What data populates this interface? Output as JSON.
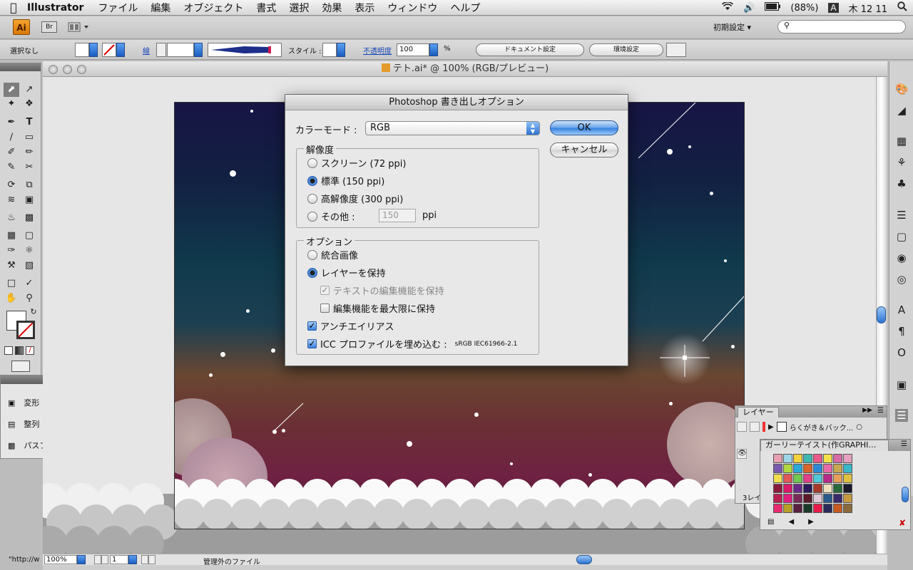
{
  "menubar": {
    "app_name": "Illustrator",
    "menus": [
      "ファイル",
      "編集",
      "オブジェクト",
      "書式",
      "選択",
      "効果",
      "表示",
      "ウィンドウ",
      "ヘルプ"
    ],
    "battery": "(88%)",
    "input_indicator": "A",
    "clock": "木 12 11"
  },
  "appbar": {
    "ai_badge": "Ai",
    "br_badge": "Br",
    "workspace": "初期設定 ▾"
  },
  "controlbar": {
    "selection_status": "選択なし",
    "stroke_label": "線",
    "style_label": "スタイル :",
    "opacity_label": "不透明度",
    "opacity_value": "100",
    "percent": "%",
    "document_settings": "ドキュメント設定",
    "preferences": "環境設定"
  },
  "document": {
    "title": "テト.ai* @ 100% (RGB/プレビュー)"
  },
  "statusbar": {
    "url_text": "\"http://w",
    "zoom": "100%",
    "page": "1",
    "status_text": "管理外のファイル"
  },
  "leftpanel": {
    "items": [
      "変形",
      "整列",
      "パスファインダ"
    ]
  },
  "layers_panel": {
    "tab": "レイヤー",
    "layer_name": "らくがき＆バック...",
    "footer": "3レイ"
  },
  "swatches_panel": {
    "tab": "ガーリーテイスト(作GRAPHI…"
  },
  "dialog": {
    "title": "Photoshop 書き出しオプション",
    "color_mode_label": "カラーモード :",
    "color_mode_value": "RGB",
    "ok": "OK",
    "cancel": "キャンセル",
    "resolution_group": "解像度",
    "resolution_options": [
      "スクリーン (72 ppi)",
      "標準 (150 ppi)",
      "高解像度 (300 ppi)",
      "その他 :"
    ],
    "resolution_selected": 1,
    "other_value": "150",
    "other_unit": "ppi",
    "options_group": "オプション",
    "flat_image": "統合画像",
    "keep_layers": "レイヤーを保持",
    "keep_text_editable": "テキストの編集機能を保持",
    "max_editability": "編集機能を最大限に保持",
    "antialias": "アンチエイリアス",
    "embed_icc": "ICC プロファイルを埋め込む :",
    "icc_profile": "sRGB IEC61966-2.1"
  }
}
